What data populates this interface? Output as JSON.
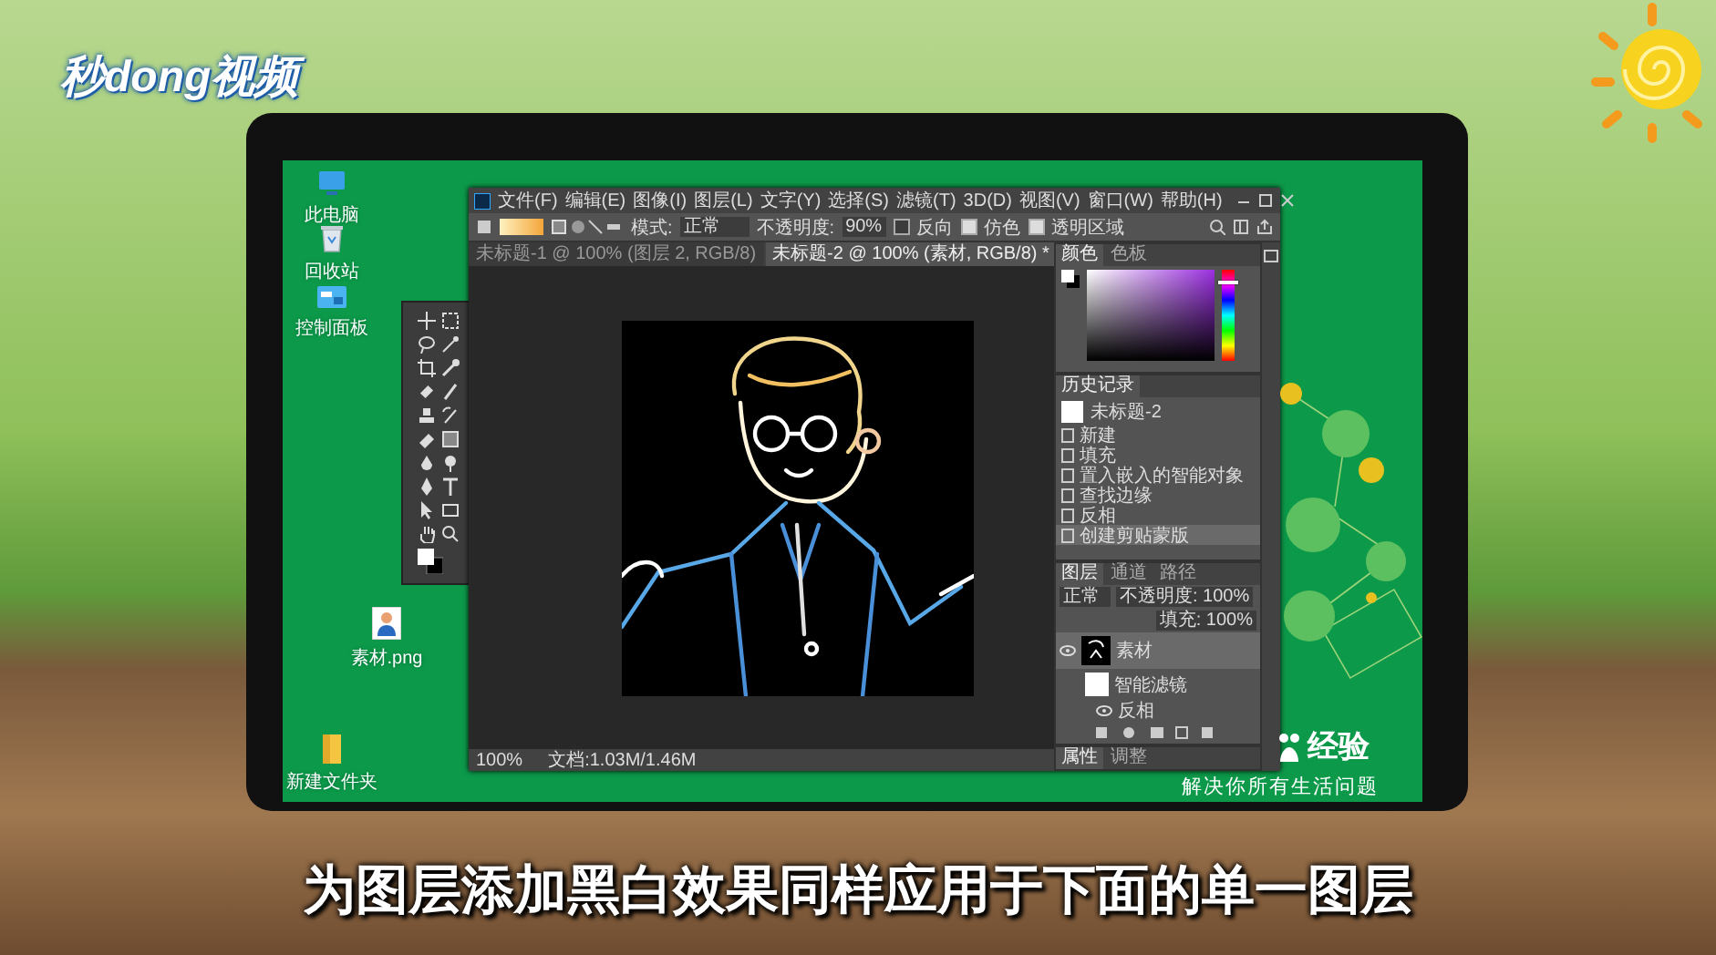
{
  "logo": {
    "text": "秒dong视频"
  },
  "desktop": {
    "icons": [
      {
        "label": "此电脑",
        "kind": "computer"
      },
      {
        "label": "回收站",
        "kind": "bin"
      },
      {
        "label": "控制面板",
        "kind": "panel"
      },
      {
        "label": "素材.png",
        "kind": "image"
      },
      {
        "label": "新建文件夹",
        "kind": "folder"
      }
    ]
  },
  "photoshop": {
    "menu": [
      "文件(F)",
      "编辑(E)",
      "图像(I)",
      "图层(L)",
      "文字(Y)",
      "选择(S)",
      "滤镜(T)",
      "3D(D)",
      "视图(V)",
      "窗口(W)",
      "帮助(H)"
    ],
    "options": {
      "mode_label": "模式:",
      "mode": "正常",
      "opacity_label": "不透明度:",
      "opacity": "90%",
      "checks": [
        {
          "label": "反向",
          "checked": false
        },
        {
          "label": "仿色",
          "checked": true
        },
        {
          "label": "透明区域",
          "checked": true
        }
      ]
    },
    "tabs": [
      {
        "label": "未标题-1 @ 100% (图层 2, RGB/8)",
        "selected": false
      },
      {
        "label": "未标题-2 @ 100% (素材, RGB/8) *",
        "selected": true
      }
    ],
    "status": {
      "zoom": "100%",
      "document": "文档:1.03M/1.46M"
    },
    "color_panel": {
      "tabs": [
        {
          "label": "颜色",
          "selected": true
        },
        {
          "label": "色板",
          "selected": false
        }
      ],
      "hue_slider": {
        "level": 0.88
      }
    },
    "history_panel": {
      "title": "历史记录",
      "snapshot": "未标题-2",
      "items": [
        {
          "label": "新建",
          "selected": false
        },
        {
          "label": "填充",
          "selected": false
        },
        {
          "label": "置入嵌入的智能对象",
          "selected": false
        },
        {
          "label": "查找边缘",
          "selected": false
        },
        {
          "label": "反相",
          "selected": false
        },
        {
          "label": "创建剪贴蒙版",
          "selected": true
        }
      ]
    },
    "layers_panel": {
      "tabs": [
        {
          "label": "图层",
          "selected": true
        },
        {
          "label": "通道",
          "selected": false
        },
        {
          "label": "路径",
          "selected": false
        }
      ],
      "blend": "正常",
      "opacity": "不透明度: 100%",
      "fill": "填充: 100%",
      "layers": [
        {
          "name": "素材",
          "kind": "layer",
          "selected": true
        },
        {
          "name": "智能滤镜",
          "kind": "filter",
          "selected": false
        },
        {
          "name": "反相",
          "kind": "effect",
          "selected": false
        }
      ]
    },
    "bottom_tabs": [
      {
        "label": "属性",
        "selected": true
      },
      {
        "label": "调整",
        "selected": false
      }
    ]
  },
  "baidu": {
    "brand": "经验",
    "slogan": "解决你所有生活问题"
  },
  "subtitle": "为图层添加黑白效果同样应用于下面的单一图层"
}
